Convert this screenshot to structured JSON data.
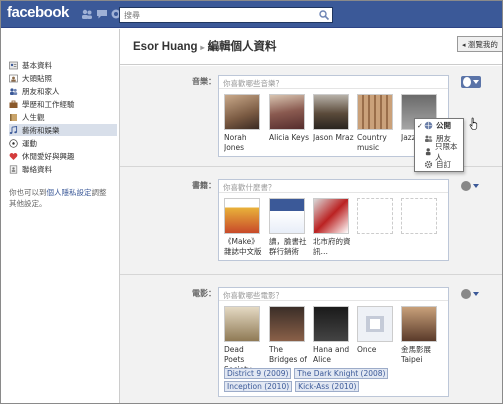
{
  "topbar": {
    "logo": "facebook",
    "search_placeholder": "搜尋"
  },
  "sidebar": {
    "items": [
      {
        "label": "基本資料",
        "icon": "profile-card-icon"
      },
      {
        "label": "大頭貼照",
        "icon": "photo-icon"
      },
      {
        "label": "朋友和家人",
        "icon": "friends-icon"
      },
      {
        "label": "學歷和工作經驗",
        "icon": "briefcase-icon"
      },
      {
        "label": "人生觀",
        "icon": "book-icon"
      },
      {
        "label": "藝術和娛樂",
        "icon": "music-note-icon",
        "active": true
      },
      {
        "label": "運動",
        "icon": "soccer-ball-icon"
      },
      {
        "label": "休閒愛好與興趣",
        "icon": "heart-icon"
      },
      {
        "label": "聯絡資料",
        "icon": "address-book-icon"
      }
    ],
    "privacy_note_pre": "你也可以到",
    "privacy_note_link": "個人隱私設定",
    "privacy_note_post": "調整其他設定。"
  },
  "header": {
    "user_name": "Esor Huang",
    "separator": "▸",
    "page_title": "編輯個人資料",
    "view_profile_button": "瀏覽我的"
  },
  "sections": {
    "music": {
      "label": "音樂：",
      "placeholder": "你喜歡哪些音樂？",
      "items": [
        "Norah Jones",
        "Alicia Keys",
        "Jason Mraz",
        "Country music",
        "Jazz"
      ]
    },
    "books": {
      "label": "書籍：",
      "placeholder": "你喜歡什麼書？",
      "items": [
        "《Make》雜誌中文版",
        "讀，臉書社群行銷術",
        "北市府的資訊…",
        "",
        ""
      ]
    },
    "movies": {
      "label": "電影：",
      "placeholder": "你喜歡哪些電影？",
      "items": [
        "Dead Poets Society",
        "The Bridges of",
        "Hana and Alice",
        "Once",
        "金馬影展 Taipei"
      ],
      "tags": [
        "District 9 (2009)",
        "The Dark Knight (2008)",
        "Inception (2010)",
        "Kick-Ass (2010)"
      ]
    }
  },
  "privacy_menu": {
    "options": [
      {
        "label": "公開",
        "icon": "globe-icon",
        "selected": true
      },
      {
        "label": "朋友",
        "icon": "friends-icon",
        "selected": false
      },
      {
        "label": "只限本人",
        "icon": "lock-person-icon",
        "selected": false
      },
      {
        "label": "自訂",
        "icon": "gear-icon",
        "selected": false
      }
    ]
  },
  "colors": {
    "brand_blue": "#3b5998",
    "sidebar_active": "#d8dfea"
  }
}
